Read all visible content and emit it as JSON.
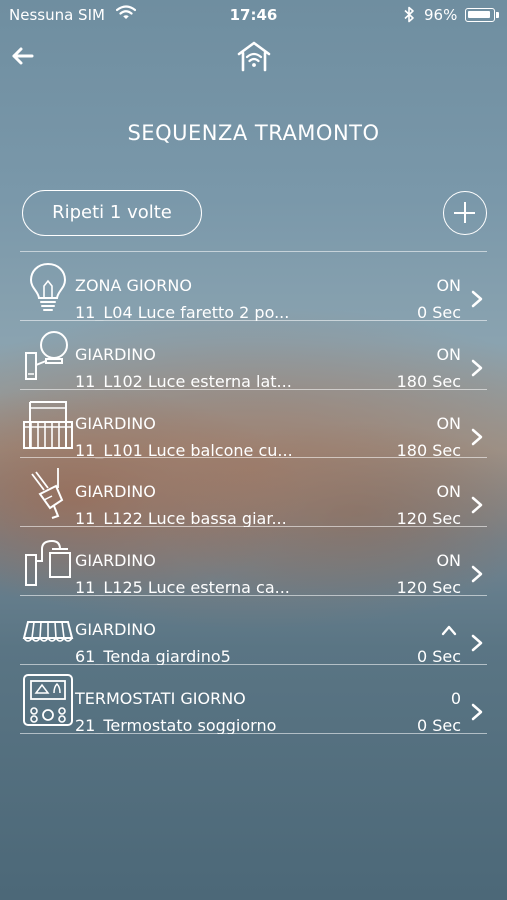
{
  "status_bar": {
    "carrier": "Nessuna SIM",
    "time": "17:46",
    "battery": "96%"
  },
  "header": {
    "back_icon": "back-arrow-icon",
    "logo_icon": "home-wifi-icon"
  },
  "title": "SEQUENZA TRAMONTO",
  "repeat_button": "Ripeti 1 volte",
  "add_button_icon": "plus-circle-icon",
  "rows": [
    {
      "icon": "bulb-icon",
      "zone": "ZONA GIORNO",
      "device": "11_L04 Luce faretto 2 po...",
      "state": "ON",
      "delay": "0 Sec"
    },
    {
      "icon": "wall-lamp-globe-icon",
      "zone": "GIARDINO",
      "device": "11_L102 Luce esterna lat...",
      "state": "ON",
      "delay": "180 Sec"
    },
    {
      "icon": "balcony-icon",
      "zone": "GIARDINO",
      "device": "11_L101 Luce balcone cu...",
      "state": "ON",
      "delay": "180 Sec"
    },
    {
      "icon": "spotlight-icon",
      "zone": "GIARDINO",
      "device": "11_L122 Luce bassa giar...",
      "state": "ON",
      "delay": "120 Sec"
    },
    {
      "icon": "wall-lamp-lantern-icon",
      "zone": "GIARDINO",
      "device": "11_L125 Luce esterna ca...",
      "state": "ON",
      "delay": "120 Sec"
    },
    {
      "icon": "awning-icon",
      "zone": "GIARDINO",
      "device": "61_Tenda giardino5",
      "state": "",
      "state_icon": "arrow-up-icon",
      "delay": "0 Sec"
    },
    {
      "icon": "thermostat-icon",
      "zone": "TERMOSTATI GIORNO",
      "device": "21_Termostato soggiorno",
      "state": "0",
      "delay": "0 Sec"
    }
  ]
}
